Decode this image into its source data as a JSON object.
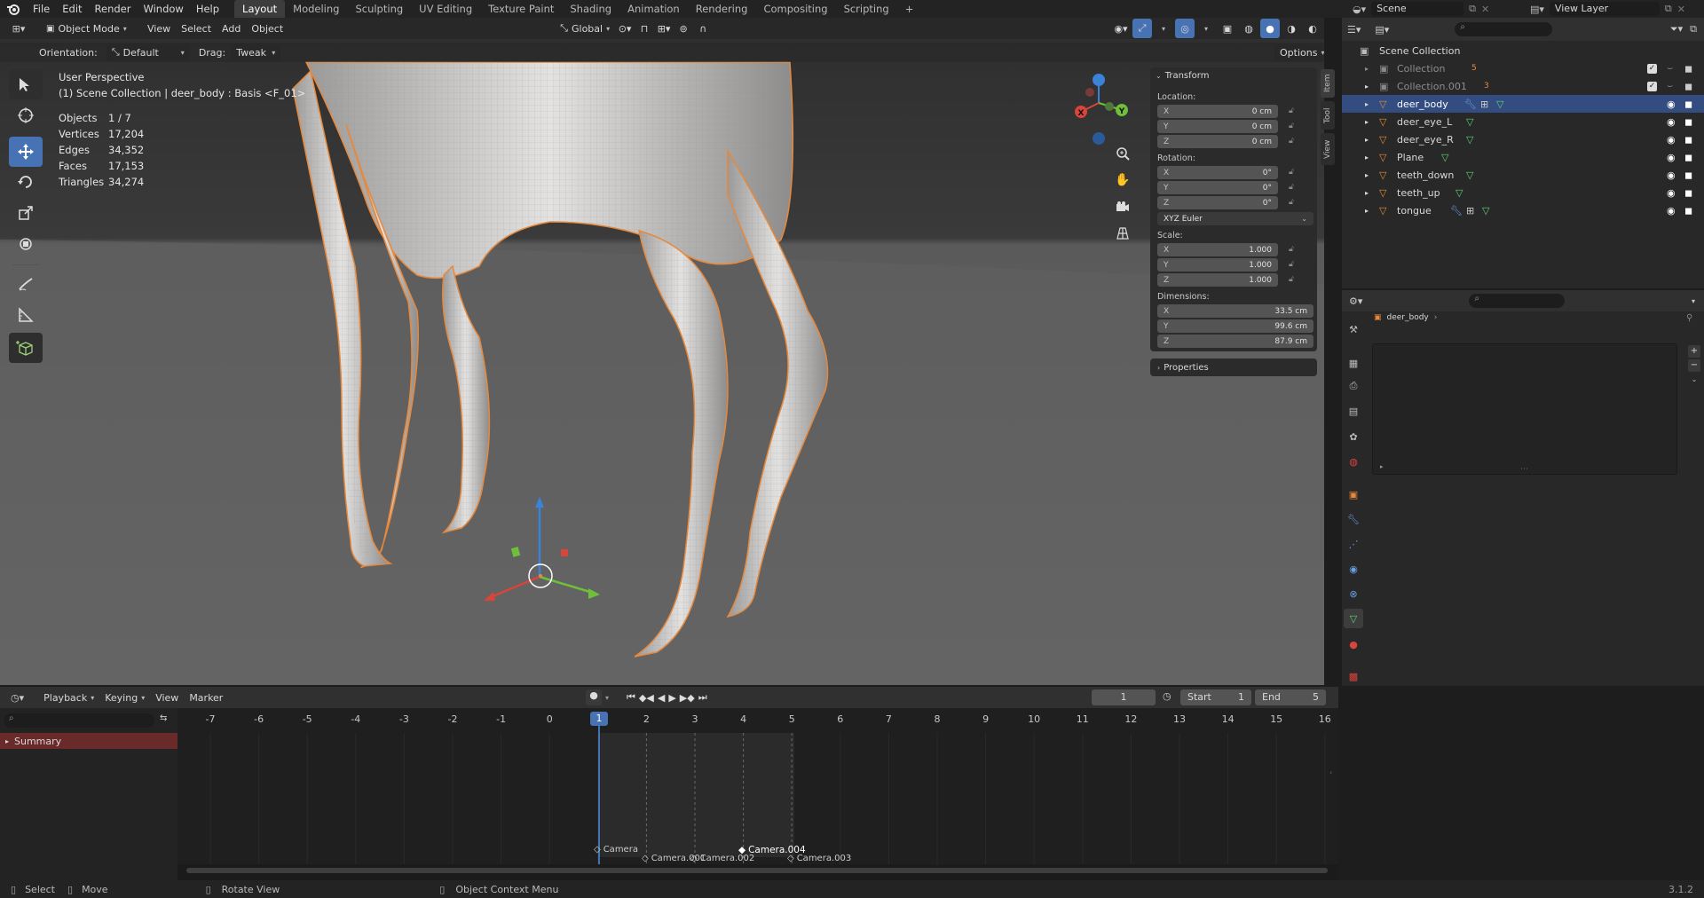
{
  "app": {
    "logo": "blender-logo-icon"
  },
  "menu": [
    "File",
    "Edit",
    "Render",
    "Window",
    "Help"
  ],
  "workspaces": [
    "Layout",
    "Modeling",
    "Sculpting",
    "UV Editing",
    "Texture Paint",
    "Shading",
    "Animation",
    "Rendering",
    "Compositing",
    "Scripting",
    "+"
  ],
  "scene": {
    "name": "Scene",
    "view_layer": "View Layer"
  },
  "viewport_header": {
    "mode": "Object Mode",
    "menus": [
      "View",
      "Select",
      "Add",
      "Object"
    ],
    "transform_orientation": "Global",
    "orientation_label": "Orientation:",
    "orientation_value": "Default",
    "drag_label": "Drag:",
    "drag_value": "Tweak",
    "options_label": "Options"
  },
  "overlay": {
    "title": "User Perspective",
    "subtitle": "(1) Scene Collection | deer_body : Basis <F_01>",
    "stats": [
      {
        "label": "Objects",
        "value": "1 / 7"
      },
      {
        "label": "Vertices",
        "value": "17,204"
      },
      {
        "label": "Edges",
        "value": "34,352"
      },
      {
        "label": "Faces",
        "value": "17,153"
      },
      {
        "label": "Triangles",
        "value": "34,274"
      }
    ]
  },
  "gizmo": {
    "x": "X",
    "y": "Y"
  },
  "npanel": {
    "section": "Transform",
    "location_label": "Location:",
    "location": [
      {
        "k": "X",
        "v": "0 cm"
      },
      {
        "k": "Y",
        "v": "0 cm"
      },
      {
        "k": "Z",
        "v": "0 cm"
      }
    ],
    "rotation_label": "Rotation:",
    "rotation": [
      {
        "k": "X",
        "v": "0°"
      },
      {
        "k": "Y",
        "v": "0°"
      },
      {
        "k": "Z",
        "v": "0°"
      }
    ],
    "rotation_mode": "XYZ Euler",
    "scale_label": "Scale:",
    "scale": [
      {
        "k": "X",
        "v": "1.000"
      },
      {
        "k": "Y",
        "v": "1.000"
      },
      {
        "k": "Z",
        "v": "1.000"
      }
    ],
    "dimensions_label": "Dimensions:",
    "dimensions": [
      {
        "k": "X",
        "v": "33.5 cm"
      },
      {
        "k": "Y",
        "v": "99.6 cm"
      },
      {
        "k": "Z",
        "v": "87.9 cm"
      }
    ],
    "properties_label": "Properties",
    "tabs": [
      "Item",
      "Tool",
      "View"
    ]
  },
  "outliner": {
    "root": "Scene Collection",
    "items": [
      {
        "name": "Collection",
        "badge": "5"
      },
      {
        "name": "Collection.001",
        "badge": "3"
      },
      {
        "name": "deer_body",
        "selected": true
      },
      {
        "name": "deer_eye_L"
      },
      {
        "name": "deer_eye_R"
      },
      {
        "name": "Plane"
      },
      {
        "name": "teeth_down"
      },
      {
        "name": "teeth_up"
      },
      {
        "name": "tongue"
      }
    ]
  },
  "properties": {
    "object_name": "deer_body"
  },
  "timeline": {
    "menus": [
      "Playback",
      "Keying",
      "View",
      "Marker"
    ],
    "current_frame": "1",
    "start_label": "Start",
    "start": "1",
    "end_label": "End",
    "end": "5",
    "ticks": [
      "-7",
      "-6",
      "-5",
      "-4",
      "-3",
      "-2",
      "-1",
      "0",
      "1",
      "2",
      "3",
      "4",
      "5",
      "6",
      "7",
      "8",
      "9",
      "10",
      "11",
      "12",
      "13",
      "14",
      "15",
      "16"
    ],
    "summary": "Summary",
    "markers": [
      "Camera",
      "Camera.001",
      "Camera.002",
      "Camera.004",
      "Camera.003"
    ]
  },
  "status": {
    "select": "Select",
    "move": "Move",
    "rotate": "Rotate View",
    "context": "Object Context Menu",
    "version": "3.1.2"
  },
  "colors": {
    "accent": "#4772b3",
    "selection_orange": "#e8883a",
    "summary_red": "#6b2a2a"
  }
}
